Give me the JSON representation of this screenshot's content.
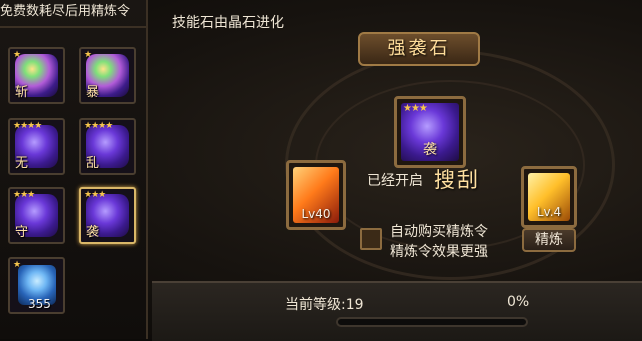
{
  "left_panel": {
    "header": "免费数耗尽后用精炼令",
    "items": [
      {
        "label": "斩",
        "stars": "★",
        "kind": "multi",
        "selected": false
      },
      {
        "label": "暴",
        "stars": "★",
        "kind": "multi",
        "selected": false
      },
      {
        "label": "无",
        "stars": "★★★★",
        "kind": "purple",
        "selected": false
      },
      {
        "label": "乱",
        "stars": "★★★★",
        "kind": "purple",
        "selected": false
      },
      {
        "label": "守",
        "stars": "★★★",
        "kind": "purple",
        "selected": false
      },
      {
        "label": "袭",
        "stars": "★★★",
        "kind": "purple",
        "selected": true
      },
      {
        "label": "355",
        "stars": "★",
        "kind": "blue-crystal",
        "selected": false
      }
    ]
  },
  "main": {
    "subtitle": "技能石由晶石进化",
    "title": "强袭石",
    "center_slot": {
      "stars": "★★★",
      "label": "袭"
    },
    "left_slot": {
      "level": "Lv40"
    },
    "right_slot": {
      "level": "Lv.4"
    },
    "opened_text": "已经开启",
    "opened_skill": "搜刮",
    "auto_buy_line1": "自动购买精炼令",
    "auto_buy_line2": "精炼令效果更强",
    "auto_buy_checked": false,
    "refine_button": "精炼"
  },
  "bottom": {
    "level_text": "当前等级:19",
    "percent_text": "0%",
    "progress": 0
  },
  "colors": {
    "gold_border": "#8c6b3f",
    "selected_border": "#d9b768",
    "star": "#f6c64d"
  }
}
